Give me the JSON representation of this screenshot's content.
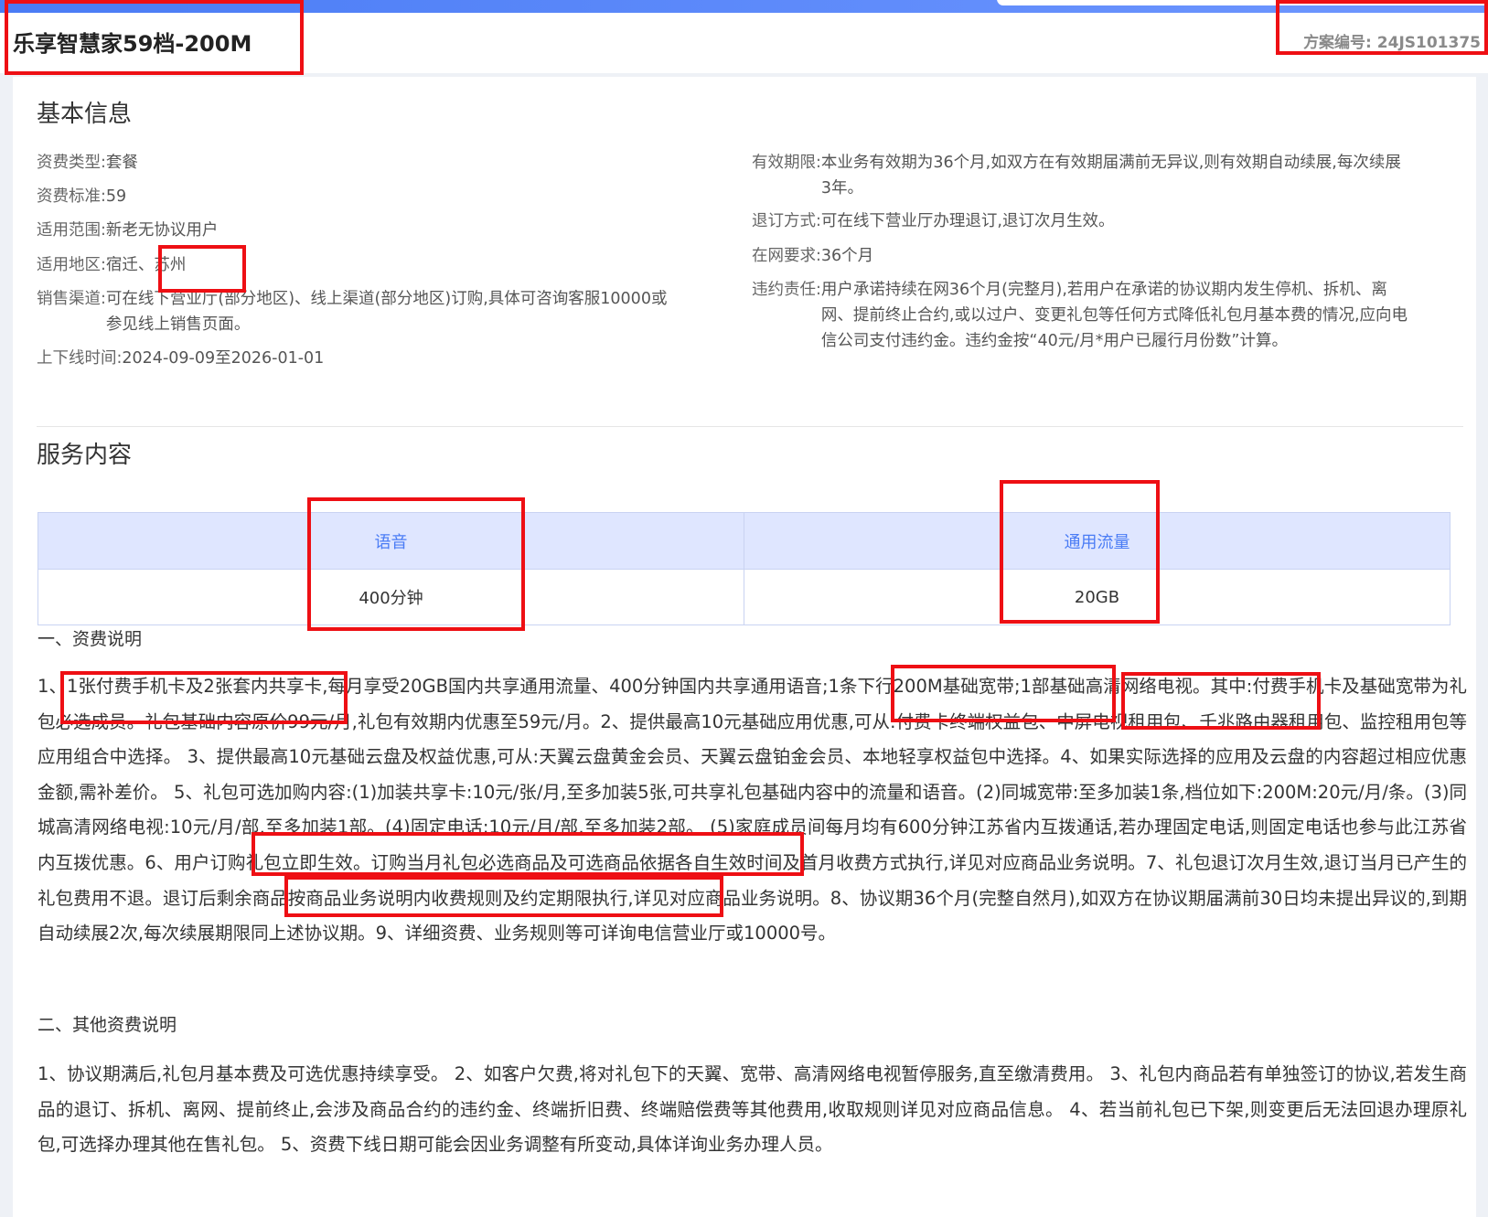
{
  "header": {
    "title": "乐享智慧家59档-200M",
    "plan_label": "方案编号:",
    "plan_number": "24JS101375"
  },
  "basic_info": {
    "section_title": "基本信息",
    "left": [
      {
        "label": "资费类型:",
        "value": "套餐"
      },
      {
        "label": "资费标准:",
        "value": "59"
      },
      {
        "label": "适用范围:",
        "value": "新老无协议用户"
      },
      {
        "label": "适用地区:",
        "value": "宿迁、苏州"
      },
      {
        "label": "销售渠道:",
        "value": "可在线下营业厅(部分地区)、线上渠道(部分地区)订购,具体可咨询客服10000或参见线上销售页面。"
      },
      {
        "label": "上下线时间:",
        "value": "2024-09-09至2026-01-01"
      }
    ],
    "right": [
      {
        "label": "有效期限:",
        "value": "本业务有效期为36个月,如双方在有效期届满前无异议,则有效期自动续展,每次续展3年。"
      },
      {
        "label": "退订方式:",
        "value": "可在线下营业厅办理退订,退订次月生效。"
      },
      {
        "label": "在网要求:",
        "value": "36个月"
      },
      {
        "label": "违约责任:",
        "value": "用户承诺持续在网36个月(完整月),若用户在承诺的协议期内发生停机、拆机、离网、提前终止合约,或以过户、变更礼包等任何方式降低礼包月基本费的情况,应向电信公司支付违约金。违约金按“40元/月*用户已履行月份数”计算。"
      }
    ]
  },
  "service": {
    "section_title": "服务内容",
    "headers": [
      "语音",
      "通用流量"
    ],
    "values": [
      "400分钟",
      "20GB"
    ]
  },
  "fee_desc": {
    "title": "一、资费说明",
    "text": "1、1张付费手机卡及2张套内共享卡,每月享受20GB国内共享通用流量、400分钟国内共享通用语音;1条下行200M基础宽带;1部基础高清网络电视。其中:付费手机卡及基础宽带为礼包必选成员。礼包基础内容原价99元/月,礼包有效期内优惠至59元/月。2、提供最高10元基础应用优惠,可从:付费卡终端权益包、中屏电视租用包、千兆路由器租用包、监控租用包等应用组合中选择。 3、提供最高10元基础云盘及权益优惠,可从:天翼云盘黄金会员、天翼云盘铂金会员、本地轻享权益包中选择。4、如果实际选择的应用及云盘的内容超过相应优惠金额,需补差价。 5、礼包可选加购内容:(1)加装共享卡:10元/张/月,至多加装5张,可共享礼包基础内容中的流量和语音。(2)同城宽带:至多加装1条,档位如下:200M:20元/月/条。(3)同城高清网络电视:10元/月/部,至多加装1部。(4)固定电话:10元/月/部,至多加装2部。 (5)家庭成员间每月均有600分钟江苏省内互拨通话,若办理固定电话,则固定电话也参与此江苏省内互拨优惠。6、用户订购礼包立即生效。订购当月礼包必选商品及可选商品依据各自生效时间及首月收费方式执行,详见对应商品业务说明。7、礼包退订次月生效,退订当月已产生的礼包费用不退。退订后剩余商品按商品业务说明内收费规则及约定期限执行,详见对应商品业务说明。8、协议期36个月(完整自然月),如双方在协议期届满前30日均未提出异议的,到期自动续展2次,每次续展期限同上述协议期。9、详细资费、业务规则等可详询电信营业厅或10000号。"
  },
  "other_desc": {
    "title": "二、其他资费说明",
    "text": "1、协议期满后,礼包月基本费及可选优惠持续享受。 2、如客户欠费,将对礼包下的天翼、宽带、高清网络电视暂停服务,直至缴清费用。 3、礼包内商品若有单独签订的协议,若发生商品的退订、拆机、离网、提前终止,会涉及商品合约的违约金、终端折旧费、终端赔偿费等其他费用,收取规则详见对应商品信息。 4、若当前礼包已下架,则变更后无法回退办理原礼包,可选择办理其他在售礼包。 5、资费下线日期可能会因业务调整有所变动,具体详询业务办理人员。"
  },
  "colors": {
    "accent": "#4a7cf5",
    "table_header_bg": "#dfe6ff",
    "highlight": "#ee0f14"
  }
}
